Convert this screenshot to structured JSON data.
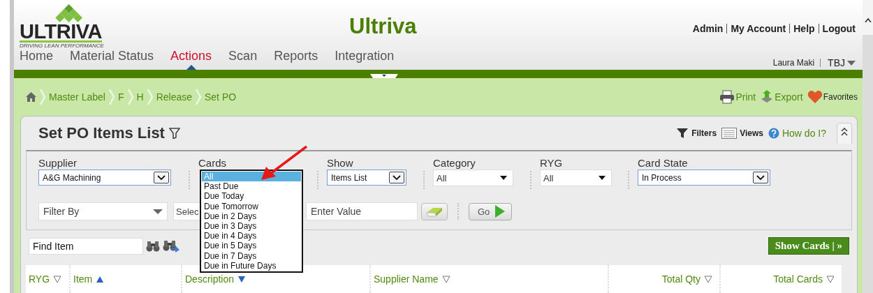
{
  "header": {
    "logo_text": "ULTRIVA",
    "logo_tagline": "DRIVING LEAN PERFORMANCE",
    "app_title": "Ultriva",
    "top_links": [
      "Admin",
      "My Account",
      "Help",
      "Logout"
    ],
    "user_name": "Laura Maki",
    "company": "TBJ"
  },
  "nav": [
    {
      "label": "Home",
      "selected": false
    },
    {
      "label": "Material Status",
      "selected": false
    },
    {
      "label": "Actions",
      "selected": true
    },
    {
      "label": "Scan",
      "selected": false
    },
    {
      "label": "Reports",
      "selected": false
    },
    {
      "label": "Integration",
      "selected": false
    }
  ],
  "breadcrumb": [
    "Master Label",
    "F",
    "H",
    "Release",
    "Set PO"
  ],
  "page_actions": [
    {
      "kind": "print",
      "label": "Print"
    },
    {
      "kind": "export",
      "label": "Export"
    },
    {
      "kind": "favorites",
      "label": "Favorites"
    }
  ],
  "panel": {
    "title": "Set PO Items List",
    "tools": [
      {
        "kind": "filters",
        "label": "Filters"
      },
      {
        "kind": "views",
        "label": "Views"
      },
      {
        "kind": "help",
        "label": "How do I?"
      }
    ]
  },
  "filters": [
    {
      "kind": "select",
      "label": "Supplier",
      "value": "A&G Machining"
    },
    {
      "kind": "list",
      "label": "Cards",
      "options": [
        {
          "label": "All",
          "selected": true
        },
        {
          "label": "Past Due",
          "selected": false
        },
        {
          "label": "Due Today",
          "selected": false
        },
        {
          "label": "Due Tomorrow",
          "selected": false
        },
        {
          "label": "Due in 2 Days",
          "selected": false
        },
        {
          "label": "Due in 3 Days",
          "selected": false
        },
        {
          "label": "Due in 4 Days",
          "selected": false
        },
        {
          "label": "Due in 5 Days",
          "selected": false
        },
        {
          "label": "Due in 7 Days",
          "selected": false
        },
        {
          "label": "Due in Future Days",
          "selected": false
        }
      ]
    },
    {
      "kind": "select",
      "label": "Show",
      "value": "Items List"
    },
    {
      "kind": "combo",
      "label": "Category",
      "value": "All"
    },
    {
      "kind": "combo",
      "label": "RYG",
      "value": "All"
    },
    {
      "kind": "select",
      "label": "Card State",
      "value": "In Process"
    }
  ],
  "filter_row": [
    {
      "kind": "combo",
      "value": "Filter By"
    },
    {
      "kind": "text",
      "value": "Selec"
    },
    {
      "kind": "input",
      "placeholder": "Enter Value"
    },
    {
      "kind": "eraser"
    },
    {
      "kind": "go",
      "label": "Go"
    }
  ],
  "find": {
    "value": "Find Item"
  },
  "show_cards": "Show Cards | »",
  "table": {
    "columns": [
      {
        "label": "RYG",
        "sorted": false
      },
      {
        "label": "Item",
        "sorted": true,
        "descending": false
      },
      {
        "label": "Description",
        "sorted": true,
        "descending": true
      },
      {
        "label": "Supplier Name",
        "sorted": false
      },
      {
        "label": "Total Qty",
        "sorted": false
      },
      {
        "label": "Total Cards",
        "sorted": false
      }
    ]
  }
}
